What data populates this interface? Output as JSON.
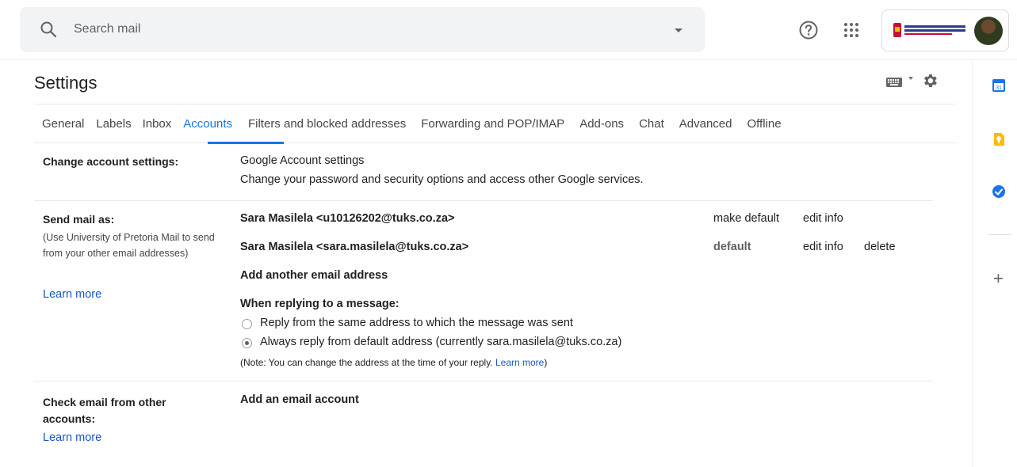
{
  "search": {
    "placeholder": "Search mail"
  },
  "header": {
    "title": "Settings"
  },
  "tabs": [
    {
      "label": "General"
    },
    {
      "label": "Labels"
    },
    {
      "label": "Inbox"
    },
    {
      "label": "Accounts"
    },
    {
      "label": "Filters and blocked addresses"
    },
    {
      "label": "Forwarding and POP/IMAP"
    },
    {
      "label": "Add-ons"
    },
    {
      "label": "Chat"
    },
    {
      "label": "Advanced"
    },
    {
      "label": "Offline"
    }
  ],
  "change_account": {
    "label": "Change account settings:",
    "link": "Google Account settings",
    "description": "Change your password and security options and access other Google services."
  },
  "send_mail": {
    "label": "Send mail as:",
    "note": "(Use University of Pretoria Mail to send from your other email addresses)",
    "learn_more": "Learn more",
    "addresses": [
      {
        "address": "Sara Masilela <u10126202@tuks.co.za>",
        "status": "make default",
        "edit": "edit info",
        "delete": ""
      },
      {
        "address": "Sara Masilela <sara.masilela@tuks.co.za>",
        "status": "default",
        "edit": "edit info",
        "delete": "delete"
      }
    ],
    "add_link": "Add another email address",
    "reply_heading": "When replying to a message:",
    "reply_options": [
      {
        "label": "Reply from the same address to which the message was sent",
        "checked": false
      },
      {
        "label": "Always reply from default address (currently sara.masilela@tuks.co.za)",
        "checked": true
      }
    ],
    "note_text": "(Note: You can change the address at the time of your reply. ",
    "note_link": "Learn more",
    "note_end": ")"
  },
  "check_email": {
    "label": "Check email from other accounts:",
    "learn_more": "Learn more",
    "add_link": "Add an email account"
  },
  "colors": {
    "accent": "#1a73e8",
    "link": "#1a57c6"
  }
}
